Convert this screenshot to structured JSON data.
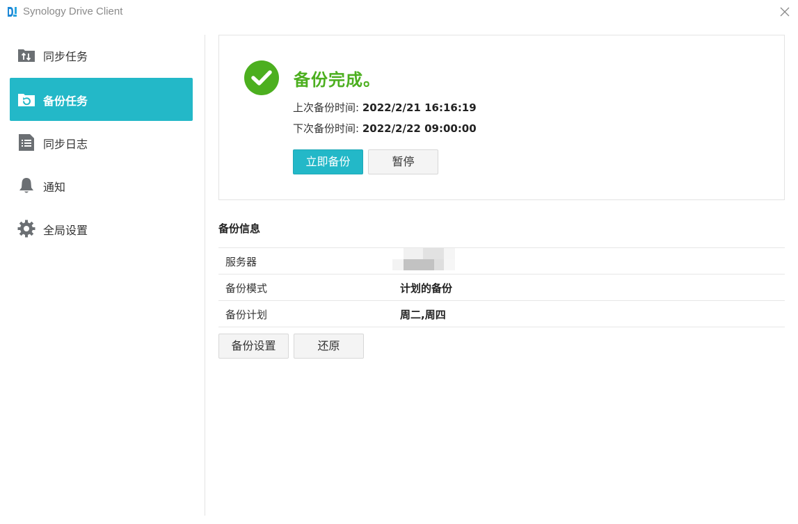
{
  "app": {
    "title": "Synology Drive Client",
    "logo_icon": "synology-drive-logo-icon",
    "close_icon": "close-icon"
  },
  "sidebar": {
    "items": [
      {
        "label": "同步任务",
        "icon": "sync-folder-icon",
        "active": false
      },
      {
        "label": "备份任务",
        "icon": "backup-folder-icon",
        "active": true
      },
      {
        "label": "同步日志",
        "icon": "log-list-icon",
        "active": false
      },
      {
        "label": "通知",
        "icon": "bell-icon",
        "active": false
      },
      {
        "label": "全局设置",
        "icon": "gear-icon",
        "active": false
      }
    ]
  },
  "status": {
    "title": "备份完成。",
    "last_label": "上次备份时间: ",
    "last_value": "2022/2/21 16:16:19",
    "next_label": "下次备份时间: ",
    "next_value": "2022/2/22 09:00:00",
    "backup_now_label": "立即备份",
    "pause_label": "暂停"
  },
  "info": {
    "section_title": "备份信息",
    "rows": [
      {
        "key": "服务器",
        "value": ""
      },
      {
        "key": "备份模式",
        "value": "计划的备份"
      },
      {
        "key": "备份计划",
        "value": "周二,周四"
      }
    ],
    "settings_label": "备份设置",
    "restore_label": "还原"
  },
  "colors": {
    "accent": "#23b8c8",
    "success": "#4caf1f"
  }
}
